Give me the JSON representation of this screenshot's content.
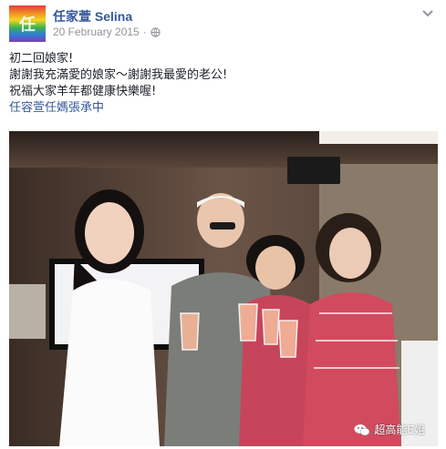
{
  "post": {
    "author": "任家萱 Selina",
    "date": "20 February 2015",
    "separator": "·",
    "privacy_icon": "globe-icon",
    "menu_icon": "chevron-down-icon",
    "avatar_icon": "rainbow-avatar"
  },
  "content": {
    "line1": "初二回娘家!",
    "line2": "謝謝我充滿愛的娘家～謝謝我最愛的老公!",
    "line3": "祝福大家羊年都健康快樂喔!",
    "mention": "任容萱任媽張承中"
  },
  "photo": {
    "watermark_text": "超高能E姐",
    "watermark_icon": "wechat-icon"
  }
}
